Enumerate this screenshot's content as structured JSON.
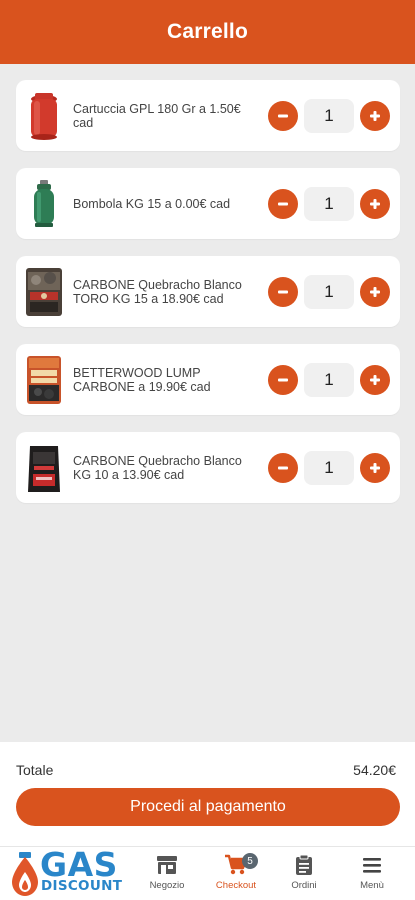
{
  "header": {
    "title": "Carrello"
  },
  "cart": {
    "items": [
      {
        "name": "Cartuccia GPL 180 Gr a 1.50€ cad",
        "quantity": "1",
        "thumb": "red-gas-cartridge"
      },
      {
        "name": "Bombola KG 15 a 0.00€ cad",
        "quantity": "1",
        "thumb": "green-gas-cylinder"
      },
      {
        "name": "CARBONE Quebracho Blanco TORO KG 15 a 18.90€ cad",
        "quantity": "1",
        "thumb": "charcoal-bag-toro"
      },
      {
        "name": "BETTERWOOD LUMP CARBONE a 19.90€ cad",
        "quantity": "1",
        "thumb": "charcoal-bag-betterwood"
      },
      {
        "name": "CARBONE Quebracho Blanco KG 10 a 13.90€ cad",
        "quantity": "1",
        "thumb": "charcoal-bag-black"
      }
    ]
  },
  "summary": {
    "total_label": "Totale",
    "total_value": "54.20€",
    "pay_button": "Procedi al pagamento"
  },
  "logo": {
    "top": "GAS",
    "bottom": "DISCOUNT"
  },
  "nav": {
    "items": [
      {
        "label": "Negozio",
        "icon": "shop-icon"
      },
      {
        "label": "Checkout",
        "icon": "cart-icon",
        "badge": "5",
        "active": true
      },
      {
        "label": "Ordini",
        "icon": "clipboard-icon"
      },
      {
        "label": "Menù",
        "icon": "menu-icon"
      }
    ]
  },
  "colors": {
    "accent": "#d9531e",
    "logo_blue": "#2a86c9",
    "background": "#ebebeb"
  }
}
